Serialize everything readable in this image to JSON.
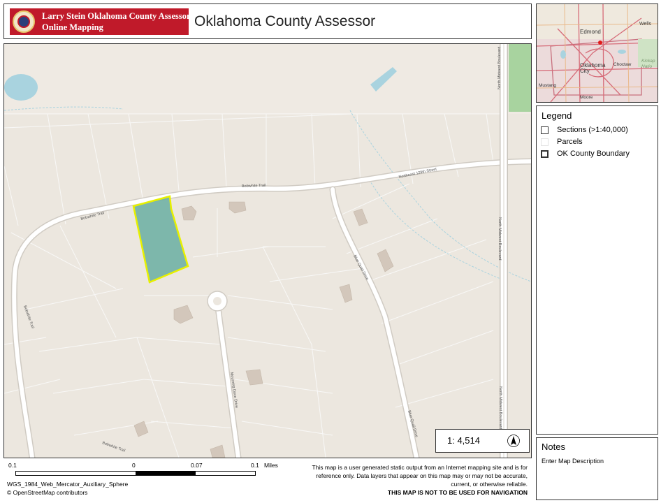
{
  "header": {
    "logo_line1": "Larry Stein Oklahoma County Assessor",
    "logo_line2": "Online Mapping",
    "title": "Oklahoma County Assessor"
  },
  "map": {
    "street_labels": {
      "bobwhite_trail_top": "Bobwhite Trail",
      "bobwhite_trail_west": "Bobwhite Trail",
      "bobwhite_trail_left": "Bobwhite Trail",
      "bobwhite_trail_bottom": "Bobwhite Trail",
      "ne_129th": "Northeast 129th Street",
      "blue_quail_north": "Blue Quail Drive",
      "blue_quail_south": "Blue Quail Drive",
      "mourning_dove": "Mourning Dove Drive",
      "midwest_1": "North Midwest Boulevard",
      "midwest_2": "North Midwest Boulevard",
      "midwest_3": "North Midwest Boulevard"
    },
    "selected_parcel_color": "#e7f000",
    "scale_text": "1: 4,514",
    "north_arrow_icon": "north-arrow-icon"
  },
  "overview": {
    "labels": {
      "edmond": "Edmond",
      "wells": "Wells",
      "oklahoma_city": "Oklahoma\nCity",
      "choctaw": "Choctaw",
      "mustang": "Mustang",
      "moore": "Moore",
      "kickapoo": "Kickap\nNatio"
    }
  },
  "legend": {
    "title": "Legend",
    "items": [
      {
        "label": "Sections (>1:40,000)",
        "swatch": "sections"
      },
      {
        "label": "Parcels",
        "swatch": "parcels"
      },
      {
        "label": "OK County Boundary",
        "swatch": "boundary"
      }
    ]
  },
  "notes": {
    "title": "Notes",
    "description": "Enter Map Description"
  },
  "footer": {
    "scale_ticks": [
      "0.1",
      "0",
      "0.07",
      "0.1"
    ],
    "scale_unit": "Miles",
    "projection": "WGS_1984_Web_Mercator_Auxiliary_Sphere",
    "attribution": "© OpenStreetMap contributors",
    "disclaimer_lines": [
      "This map is a user generated static output from an Internet mapping site and is for",
      "reference only. Data layers that appear on this map may or may not be accurate,",
      "current, or otherwise reliable."
    ],
    "disclaimer_bold": "THIS MAP IS NOT TO BE USED FOR NAVIGATION"
  }
}
